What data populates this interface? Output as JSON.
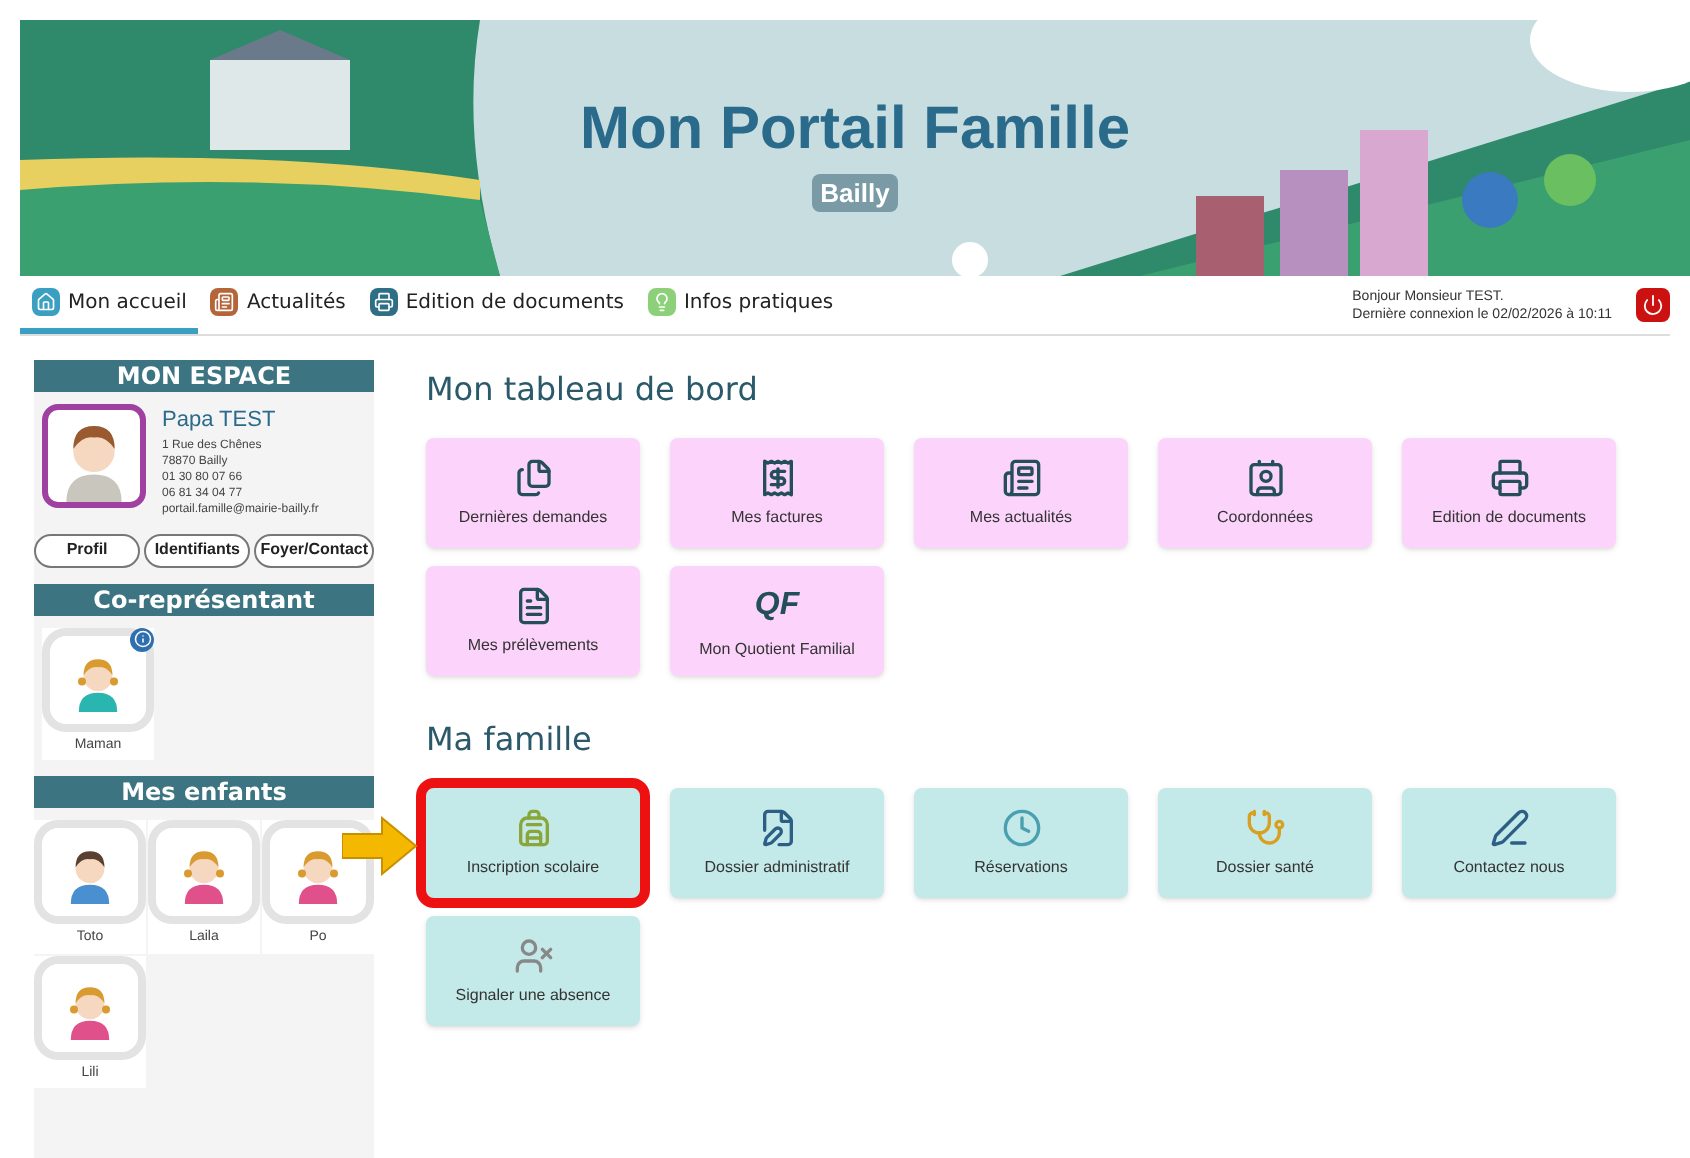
{
  "banner": {
    "title": "Mon Portail Famille",
    "subtitle": "Bailly"
  },
  "nav": {
    "tabs": [
      {
        "label": "Mon accueil",
        "selected": true
      },
      {
        "label": "Actualités",
        "selected": false
      },
      {
        "label": "Edition de documents",
        "selected": false
      },
      {
        "label": "Infos pratiques",
        "selected": false
      }
    ],
    "greeting": "Bonjour Monsieur TEST.",
    "last_login": "Dernière connexion le 02/02/2026 à 10:11"
  },
  "sidebar": {
    "mon_espace": {
      "heading": "MON ESPACE",
      "name": "Papa TEST",
      "details": [
        "1 Rue des Chênes",
        "78870 Bailly",
        "01 30 80 07 66",
        "06 81 34 04 77",
        "portail.famille@mairie-bailly.fr"
      ],
      "buttons": [
        "Profil",
        "Identifiants",
        "Foyer/Contact"
      ]
    },
    "co_representant": {
      "heading": "Co-représentant",
      "people": [
        {
          "name": "Maman",
          "kind": "woman",
          "info": true
        }
      ]
    },
    "enfants": {
      "heading": "Mes enfants",
      "people": [
        {
          "name": "Toto",
          "kind": "boy",
          "info": false
        },
        {
          "name": "Laila",
          "kind": "girl",
          "info": false
        },
        {
          "name": "Po",
          "kind": "girl",
          "info": false
        },
        {
          "name": "Lili",
          "kind": "girl",
          "info": false
        }
      ]
    }
  },
  "dashboard": {
    "heading": "Mon tableau de bord",
    "tiles": [
      {
        "label": "Dernières demandes"
      },
      {
        "label": "Mes factures"
      },
      {
        "label": "Mes actualités"
      },
      {
        "label": "Coordonnées"
      },
      {
        "label": "Edition de documents"
      },
      {
        "label": "Mes prélèvements"
      },
      {
        "label": "Mon Quotient Familial",
        "icon_text": "QF"
      }
    ]
  },
  "famille": {
    "heading": "Ma famille",
    "tiles": [
      {
        "label": "Inscription scolaire",
        "highlighted": true
      },
      {
        "label": "Dossier administratif",
        "highlighted": false
      },
      {
        "label": "Réservations",
        "highlighted": false
      },
      {
        "label": "Dossier santé",
        "highlighted": false
      },
      {
        "label": "Contactez nous",
        "highlighted": false
      },
      {
        "label": "Signaler une absence",
        "highlighted": false
      }
    ]
  }
}
